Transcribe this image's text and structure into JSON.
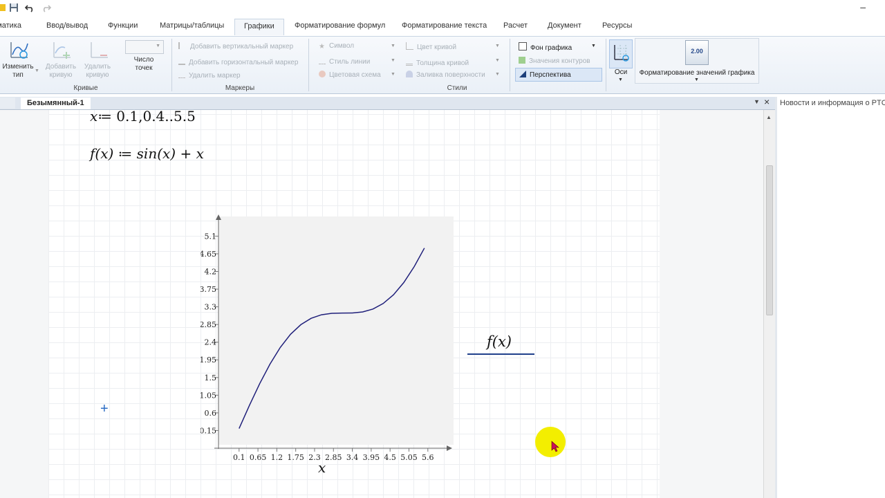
{
  "ribbon": {
    "tabs": [
      {
        "label": "Математика"
      },
      {
        "label": "Ввод/вывод"
      },
      {
        "label": "Функции"
      },
      {
        "label": "Матрицы/таблицы"
      },
      {
        "label": "Графики",
        "active": true
      },
      {
        "label": "Форматирование формул"
      },
      {
        "label": "Форматирование текста"
      },
      {
        "label": "Расчет"
      },
      {
        "label": "Документ"
      },
      {
        "label": "Ресурсы"
      }
    ],
    "curves": {
      "change_type": "Изменить тип",
      "add_curve": "Добавить кривую",
      "remove_curve": "Удалить кривую",
      "num_points": "Число точек",
      "group_label": "Кривые"
    },
    "markers": {
      "add_vertical": "Добавить вертикальный маркер",
      "add_horizontal": "Добавить горизонтальный маркер",
      "remove": "Удалить маркер",
      "group_label": "Маркеры"
    },
    "styles": {
      "symbol": "Символ",
      "line_style": "Стиль линии",
      "color_scheme": "Цветовая схема",
      "curve_color": "Цвет кривой",
      "curve_thickness": "Толщина кривой",
      "surface_fill": "Заливка поверхности",
      "plot_background": "Фон графика",
      "contour_values": "Значения контуров",
      "perspective": "Перспектива",
      "group_label": "Стили"
    },
    "axes": "Оси",
    "format_values": {
      "label": "Форматирование значений графика",
      "icon_value": "2.00"
    }
  },
  "document": {
    "tab_title": "Безымянный-1"
  },
  "news_panel": {
    "title": "Новости и информация о PTC"
  },
  "worksheet": {
    "definitions": {
      "x_def_lhs": "x",
      "x_def_rhs": "≔ 0.1,0.4..5.5",
      "f_def": "f(x) ≔ sin(x) + x"
    },
    "plot": {
      "y_axis_label": "f(x)",
      "x_axis_label": "x"
    }
  },
  "chart_data": {
    "type": "line",
    "series": [
      {
        "name": "f(x)",
        "color": "#1f1f7a",
        "x": [
          0.1,
          0.4,
          0.7,
          1.0,
          1.3,
          1.6,
          1.9,
          2.2,
          2.5,
          2.8,
          3.1,
          3.4,
          3.7,
          4.0,
          4.3,
          4.6,
          4.9,
          5.2,
          5.5
        ],
        "y": [
          0.2,
          0.789,
          1.344,
          1.841,
          2.264,
          2.6,
          2.846,
          3.008,
          3.098,
          3.135,
          3.142,
          3.144,
          3.17,
          3.243,
          3.384,
          3.606,
          3.918,
          4.317,
          4.795
        ]
      }
    ],
    "x_ticks": [
      "0.1",
      "0.65",
      "1.2",
      "1.75",
      "2.3",
      "2.85",
      "3.4",
      "3.95",
      "4.5",
      "5.05",
      "5.6"
    ],
    "y_ticks": [
      "0.15",
      "0.6",
      "1.05",
      "1.5",
      "1.95",
      "2.4",
      "2.85",
      "3.3",
      "3.75",
      "4.2",
      "4.65",
      "5.1"
    ],
    "xlim": [
      -0.5,
      6.35
    ],
    "ylim": [
      -0.3,
      5.6
    ],
    "xlabel": "x",
    "ylabel": "f(x)",
    "grid": false
  }
}
